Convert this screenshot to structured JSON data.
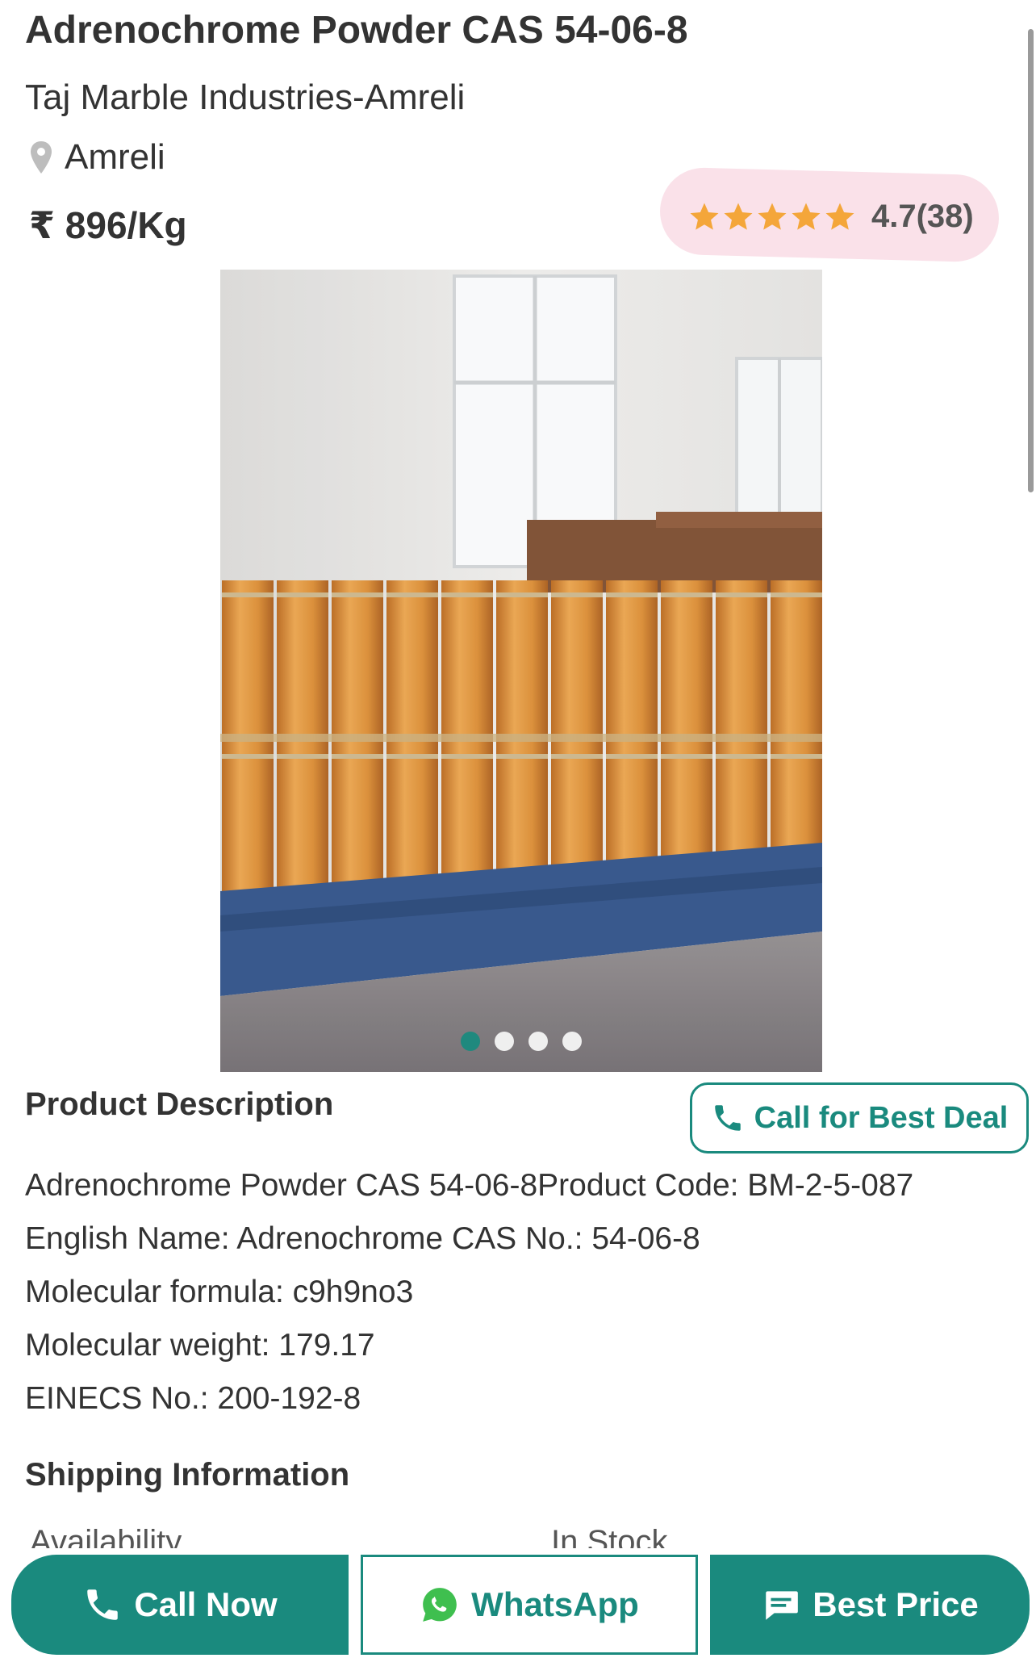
{
  "product": {
    "title": "Adrenochrome Powder CAS 54-06-8",
    "seller": "Taj Marble Industries-Amreli",
    "location": "Amreli",
    "price": "₹ 896/Kg",
    "rating": {
      "stars": 5,
      "text": "4.7(38)"
    }
  },
  "gallery": {
    "slide_count": 4,
    "active_slide": 1
  },
  "description": {
    "heading": "Product Description",
    "deal_button": "Call for Best Deal",
    "lines": [
      "Adrenochrome Powder CAS 54-06-8Product Code: BM-2-5-087",
      "English Name: Adrenochrome CAS No.: 54-06-8",
      "Molecular formula: c9h9no3",
      "Molecular weight: 179.17",
      "EINECS No.: 200-192-8"
    ]
  },
  "shipping": {
    "heading": "Shipping Information",
    "rows": [
      {
        "label": "Availability",
        "value": "In Stock"
      }
    ]
  },
  "bottom_bar": {
    "call_now": "Call Now",
    "whatsapp": "WhatsApp",
    "best_price": "Best Price"
  },
  "colors": {
    "accent": "#1a8a7e",
    "star": "#f4a63a",
    "text": "#333333",
    "rating_highlight": "#f6cdda",
    "whatsapp_icon": "#3fbf4f"
  },
  "icons": {
    "location": "map-pin-icon",
    "rating": "star-icon",
    "deal": "phone-icon",
    "call_now": "phone-icon",
    "whatsapp": "whatsapp-icon",
    "best_price": "chat-bubble-icon"
  }
}
